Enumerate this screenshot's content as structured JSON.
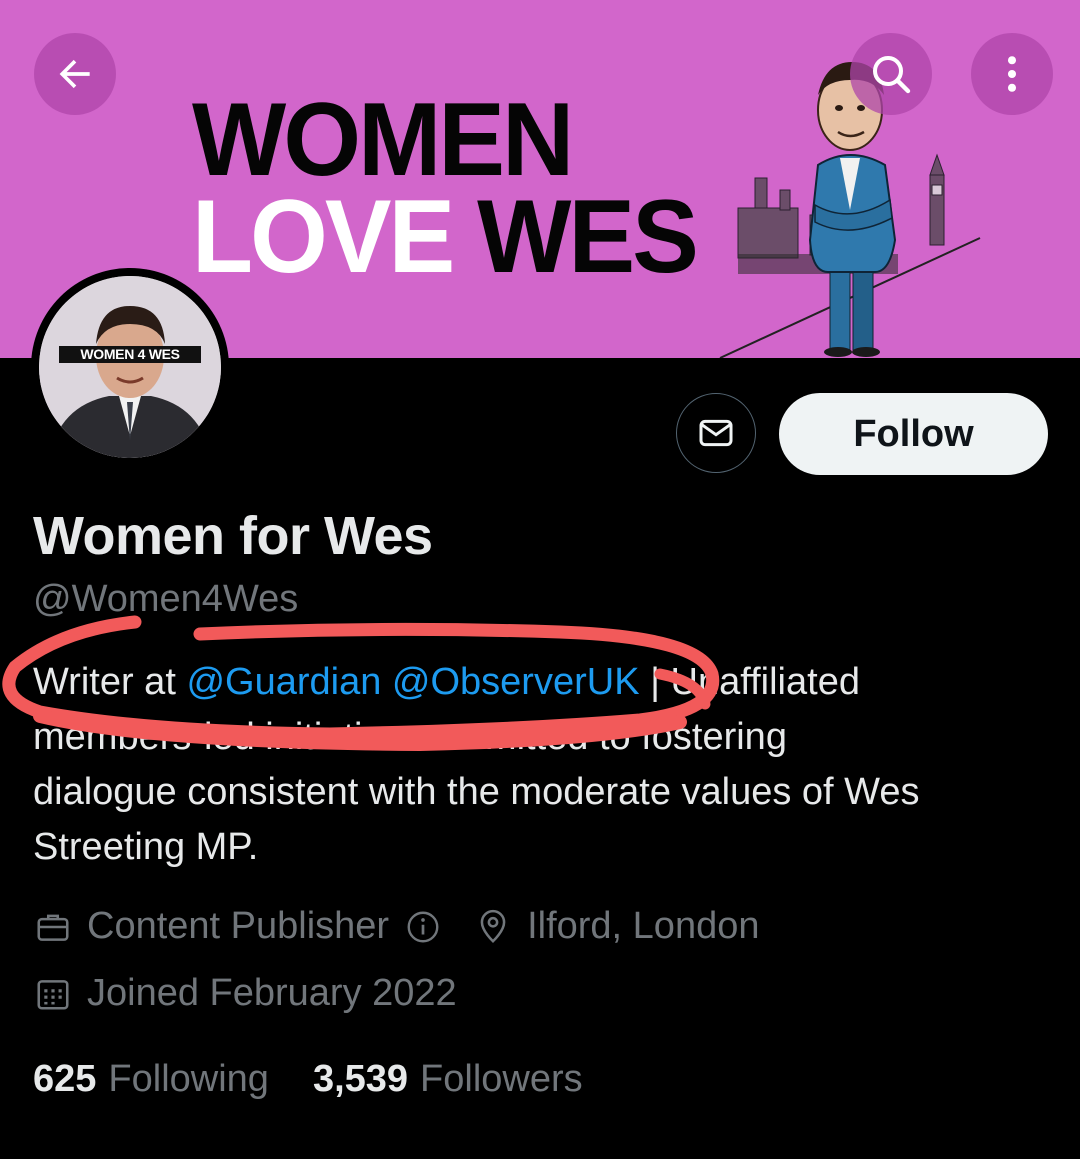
{
  "banner": {
    "line1": "WOMEN",
    "line2_white": "LOVE",
    "line2_black": "WES",
    "background": "#d266cb"
  },
  "nav": {
    "back_icon": "arrow-left-icon",
    "search_icon": "search-icon",
    "more_icon": "more-vertical-icon"
  },
  "avatar": {
    "tag": "WOMEN 4 WES"
  },
  "actions": {
    "message_icon": "envelope-icon",
    "follow_label": "Follow"
  },
  "profile": {
    "display_name": "Women for Wes",
    "handle": "@Women4Wes",
    "bio": {
      "prefix": "Writer at ",
      "mention1": "@Guardian",
      "mention2": "@ObserverUK",
      "rest_line1": " | Unaffiliated",
      "line2": "members-led initiative committed to fostering",
      "line3": "dialogue consistent with the moderate values of Wes",
      "line4": "Streeting MP."
    },
    "category": "Content Publisher",
    "location": "Ilford, London",
    "joined": "Joined February 2022"
  },
  "stats": {
    "following_count": "625",
    "following_label": "Following",
    "followers_count": "3,539",
    "followers_label": "Followers"
  },
  "colors": {
    "link": "#1d9bf0",
    "annotation": "#f25a5a"
  }
}
